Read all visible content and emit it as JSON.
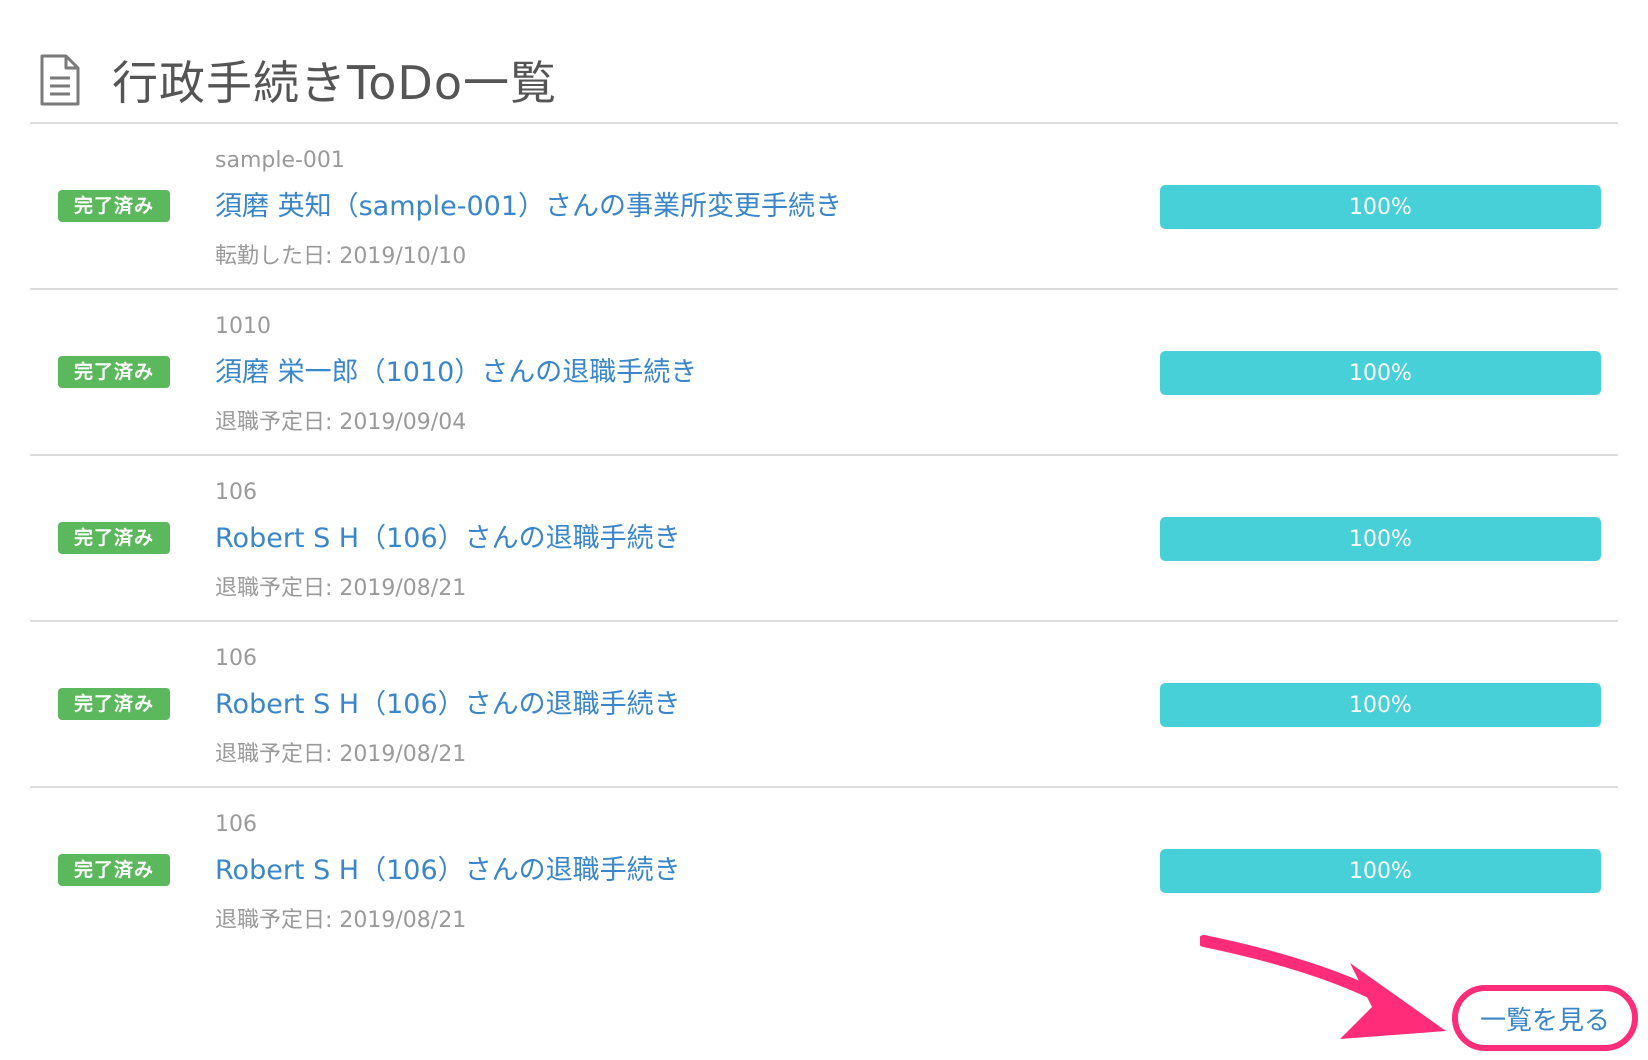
{
  "header": {
    "title": "行政手続きToDo一覧",
    "icon": "document-icon"
  },
  "items": [
    {
      "badge": "完了済み",
      "code": "sample-001",
      "title": "須磨 英知（sample-001）さんの事業所変更手続き",
      "meta": "転勤した日: 2019/10/10",
      "progress_label": "100%",
      "progress": 1.0
    },
    {
      "badge": "完了済み",
      "code": "1010",
      "title": "須磨 栄一郎（1010）さんの退職手続き",
      "meta": "退職予定日: 2019/09/04",
      "progress_label": "100%",
      "progress": 1.0
    },
    {
      "badge": "完了済み",
      "code": "106",
      "title": "Robert S H（106）さんの退職手続き",
      "meta": "退職予定日: 2019/08/21",
      "progress_label": "100%",
      "progress": 1.0
    },
    {
      "badge": "完了済み",
      "code": "106",
      "title": "Robert S H（106）さんの退職手続き",
      "meta": "退職予定日: 2019/08/21",
      "progress_label": "100%",
      "progress": 1.0
    },
    {
      "badge": "完了済み",
      "code": "106",
      "title": "Robert S H（106）さんの退職手続き",
      "meta": "退職予定日: 2019/08/21",
      "progress_label": "100%",
      "progress": 1.0
    }
  ],
  "footer": {
    "view_all_label": "一覧を見る"
  },
  "colors": {
    "badge_green": "#5cb85c",
    "link_blue": "#3a86c8",
    "progress_cyan": "#47d0d8",
    "highlight_pink": "#ff2c7a"
  }
}
